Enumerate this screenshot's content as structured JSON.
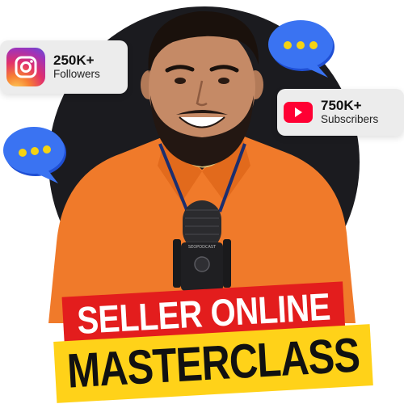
{
  "stats": {
    "instagram": {
      "value": "250K+",
      "label": "Followers"
    },
    "youtube": {
      "value": "750K+",
      "label": "Subscribers"
    }
  },
  "mic": {
    "brand": "SEOPODCAST"
  },
  "title": {
    "line1": "SELLER ONLINE",
    "line2": "MASTERCLASS"
  },
  "colors": {
    "backdrop": "#1b1b1f",
    "shirt": "#f07a2a",
    "banner_red": "#e31d1d",
    "banner_yellow": "#ffd219",
    "bubble_blue": "#2f66f0",
    "bubble_dot": "#f5d312",
    "youtube_red": "#ff0033"
  },
  "icons": [
    "instagram-icon",
    "youtube-icon",
    "chat-bubble-icon"
  ]
}
